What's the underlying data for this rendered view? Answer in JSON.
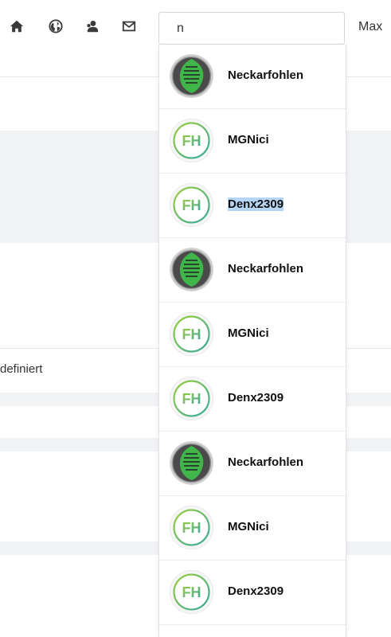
{
  "search": {
    "value": "n"
  },
  "header": {
    "user_name": "Max",
    "icons": [
      "home-icon",
      "globe-icon",
      "users-icon",
      "mail-icon"
    ]
  },
  "background": {
    "field_text": "definiert"
  },
  "results": [
    {
      "name": "Neckarfohlen",
      "avatar": "neckarfohlen-avatar-icon",
      "highlighted": false
    },
    {
      "name": "MGNici",
      "avatar": "fh-logo-icon",
      "highlighted": false
    },
    {
      "name": "Denx2309",
      "avatar": "fh-logo-icon",
      "highlighted": true
    },
    {
      "name": "Neckarfohlen",
      "avatar": "neckarfohlen-avatar-icon",
      "highlighted": false
    },
    {
      "name": "MGNici",
      "avatar": "fh-logo-icon",
      "highlighted": false
    },
    {
      "name": "Denx2309",
      "avatar": "fh-logo-icon",
      "highlighted": false
    },
    {
      "name": "Neckarfohlen",
      "avatar": "neckarfohlen-avatar-icon",
      "highlighted": false
    },
    {
      "name": "MGNici",
      "avatar": "fh-logo-icon",
      "highlighted": false
    },
    {
      "name": "Denx2309",
      "avatar": "fh-logo-icon",
      "highlighted": false
    }
  ],
  "colors": {
    "fh_green": "#7cc23a",
    "fh_gradient_end": "#3aa8a0",
    "highlight": "#b6d4f4"
  }
}
